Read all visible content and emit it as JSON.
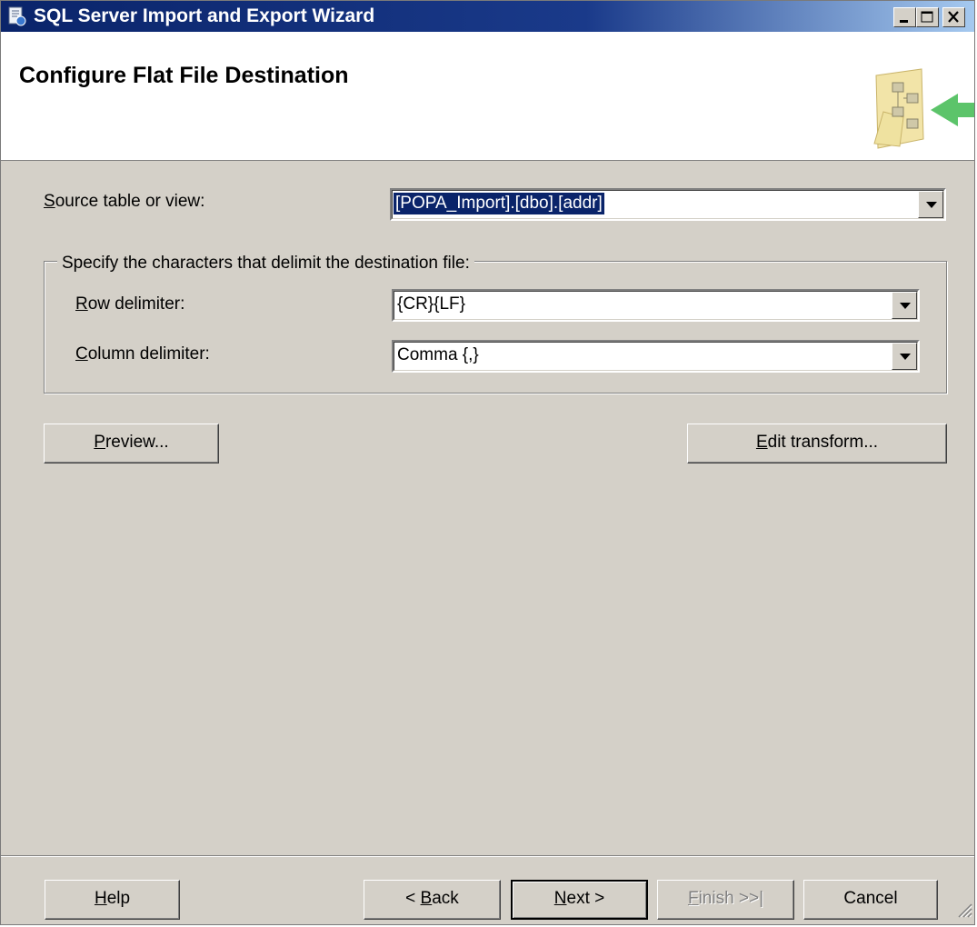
{
  "window": {
    "title": "SQL Server Import and Export Wizard",
    "icon": "wizard-app-icon",
    "controls": [
      "minimize-icon",
      "maximize-icon",
      "close-icon"
    ]
  },
  "header": {
    "title": "Configure Flat File Destination",
    "art": "wizard-banner-icon"
  },
  "form": {
    "source": {
      "label_key": "S",
      "label_rest": "ource table or view:",
      "value": "[POPA_Import].[dbo].[addr]"
    },
    "group_label": "Specify the characters that delimit the destination file:",
    "row_delimiter": {
      "label_key": "R",
      "label_rest": "ow delimiter:",
      "value": "{CR}{LF}"
    },
    "column_delimiter": {
      "label_key": "C",
      "label_rest": "olumn delimiter:",
      "value": "Comma {,}"
    }
  },
  "actions": {
    "preview": {
      "key": "P",
      "rest": "review..."
    },
    "edit_transform": {
      "key": "E",
      "rest": "dit transform..."
    }
  },
  "footer": {
    "help": {
      "key": "H",
      "rest": "elp"
    },
    "back": {
      "pre": "< ",
      "key": "B",
      "rest": "ack"
    },
    "next": {
      "key": "N",
      "rest": "ext >"
    },
    "finish": {
      "key": "F",
      "rest": "inish >>|",
      "enabled": false
    },
    "cancel": "Cancel"
  }
}
